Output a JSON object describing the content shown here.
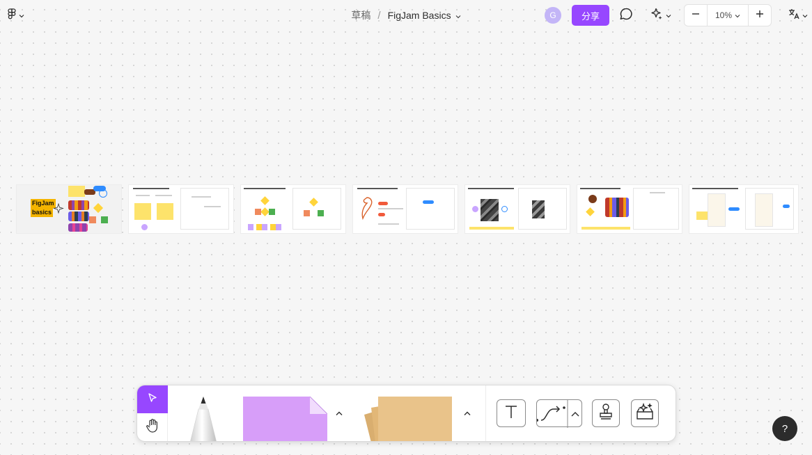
{
  "app": {
    "logo_icon": "figma-logo-icon"
  },
  "breadcrumb": {
    "folder": "草稿",
    "separator": "/",
    "file_name": "FigJam Basics"
  },
  "header": {
    "avatar_initial": "G",
    "share_label": "分享",
    "zoom_value": "10%"
  },
  "canvas": {
    "sections": [
      {
        "title_line1": "FigJam",
        "title_line2": "basics"
      },
      {},
      {},
      {},
      {},
      {},
      {}
    ]
  },
  "help": {
    "label": "?"
  },
  "colors": {
    "accent": "#9747ff",
    "sticky": "#d79ef9",
    "paper": "#e9c38a"
  }
}
